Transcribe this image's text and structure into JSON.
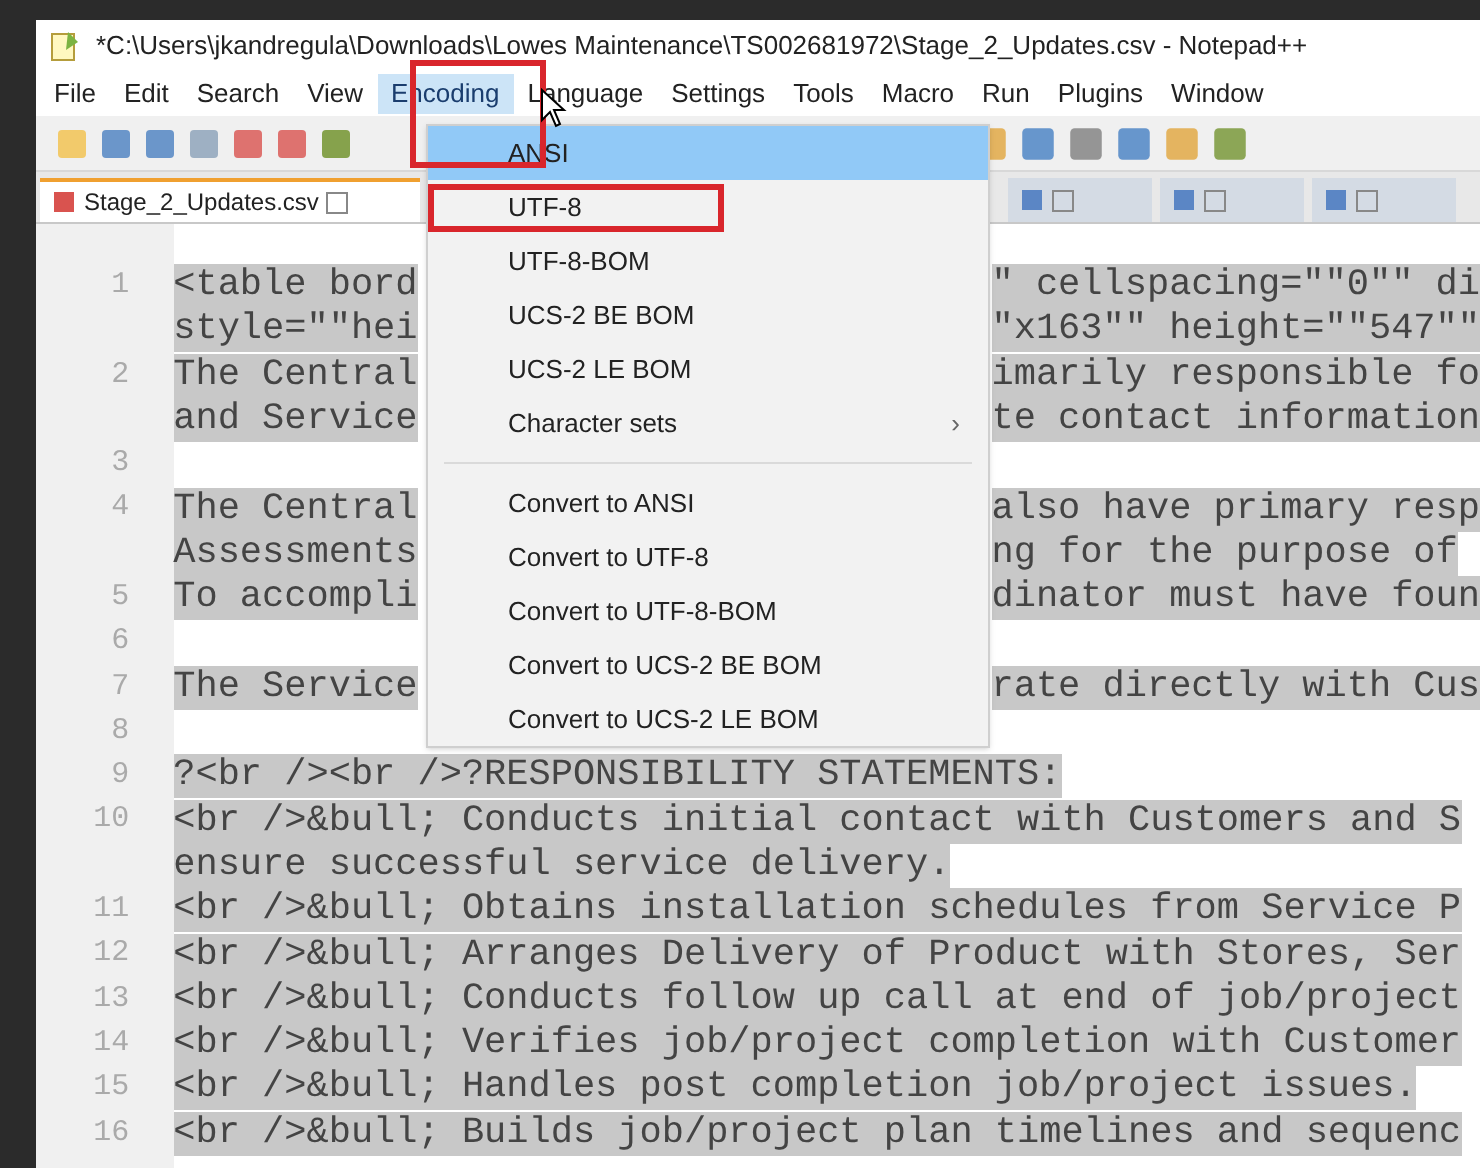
{
  "window": {
    "title": "*C:\\Users\\jkandregula\\Downloads\\Lowes Maintenance\\TS002681972\\Stage_2_Updates.csv - Notepad++"
  },
  "menu_bar": [
    {
      "label": "File",
      "selected": false
    },
    {
      "label": "Edit",
      "selected": false
    },
    {
      "label": "Search",
      "selected": false
    },
    {
      "label": "View",
      "selected": false
    },
    {
      "label": "Encoding",
      "selected": true
    },
    {
      "label": "Language",
      "selected": false
    },
    {
      "label": "Settings",
      "selected": false
    },
    {
      "label": "Tools",
      "selected": false
    },
    {
      "label": "Macro",
      "selected": false
    },
    {
      "label": "Run",
      "selected": false
    },
    {
      "label": "Plugins",
      "selected": false
    },
    {
      "label": "Window",
      "selected": false
    }
  ],
  "tabs": [
    {
      "label": "Stage_2_Updates.csv",
      "selected": true
    },
    {
      "selected": false
    },
    {
      "selected": false
    },
    {
      "selected": false
    }
  ],
  "encoding_menu": [
    {
      "kind": "item",
      "label": "ANSI",
      "selected": true
    },
    {
      "kind": "item",
      "label": "UTF-8",
      "selected": false,
      "annotated": true
    },
    {
      "kind": "item",
      "label": "UTF-8-BOM",
      "selected": false
    },
    {
      "kind": "item",
      "label": "UCS-2 BE BOM",
      "selected": false
    },
    {
      "kind": "item",
      "label": "UCS-2 LE BOM",
      "selected": false
    },
    {
      "kind": "submenu",
      "label": "Character sets",
      "arrow": "›",
      "selected": false
    },
    {
      "kind": "separator"
    },
    {
      "kind": "item",
      "label": "Convert to ANSI",
      "selected": false
    },
    {
      "kind": "item",
      "label": "Convert to UTF-8",
      "selected": false
    },
    {
      "kind": "item",
      "label": "Convert to UTF-8-BOM",
      "selected": false
    },
    {
      "kind": "item",
      "label": "Convert to UCS-2 BE BOM",
      "selected": false
    },
    {
      "kind": "item",
      "label": "Convert to UCS-2 LE BOM",
      "selected": false
    }
  ],
  "editor": {
    "lines": [
      {
        "kind": "split",
        "number": "1",
        "left": "<table bord",
        "right": "\" cellspacing=\"\"0\"\" di"
      },
      {
        "kind": "split",
        "left": "style=\"\"hei",
        "right": "\"x163\"\" height=\"\"547\"\""
      },
      {
        "kind": "split",
        "number": "2",
        "left": "The Central",
        "right": "imarily responsible fo"
      },
      {
        "kind": "split",
        "left": "and Service",
        "right": "te contact information"
      },
      {
        "kind": "blank",
        "number": "3"
      },
      {
        "kind": "split",
        "number": "4",
        "left": "The Central",
        "right": "also have primary resp"
      },
      {
        "kind": "split",
        "left": "Assessments",
        "right": "ng for the purpose of"
      },
      {
        "kind": "split",
        "number": "5",
        "left": "To accompli",
        "right": "dinator must have foun"
      },
      {
        "kind": "blank",
        "number": "6"
      },
      {
        "kind": "split",
        "number": "7",
        "left": "The Service",
        "right": "rate directly with Cus"
      },
      {
        "kind": "blank",
        "number": "8"
      },
      {
        "kind": "full",
        "number": "9",
        "text": "?<br /><br />?RESPONSIBILITY STATEMENTS:"
      },
      {
        "kind": "full",
        "number": "10",
        "text": "<br />&bull; Conducts initial contact with Customers and S"
      },
      {
        "kind": "full",
        "text": "ensure successful service delivery."
      },
      {
        "kind": "full",
        "number": "11",
        "text": "<br />&bull; Obtains installation schedules from Service P"
      },
      {
        "kind": "full",
        "number": "12",
        "text": "<br />&bull; Arranges Delivery of Product with Stores, Ser"
      },
      {
        "kind": "full",
        "number": "13",
        "text": "<br />&bull; Conducts follow up call at end of job/project"
      },
      {
        "kind": "full",
        "number": "14",
        "text": "<br />&bull; Verifies job/project completion with Customer"
      },
      {
        "kind": "full",
        "number": "15",
        "text": "<br />&bull; Handles post completion job/project issues."
      },
      {
        "kind": "full",
        "number": "16",
        "text": "<br />&bull; Builds job/project plan timelines and sequenc"
      }
    ]
  },
  "annotations": [
    {
      "kind": "highlight"
    }
  ]
}
